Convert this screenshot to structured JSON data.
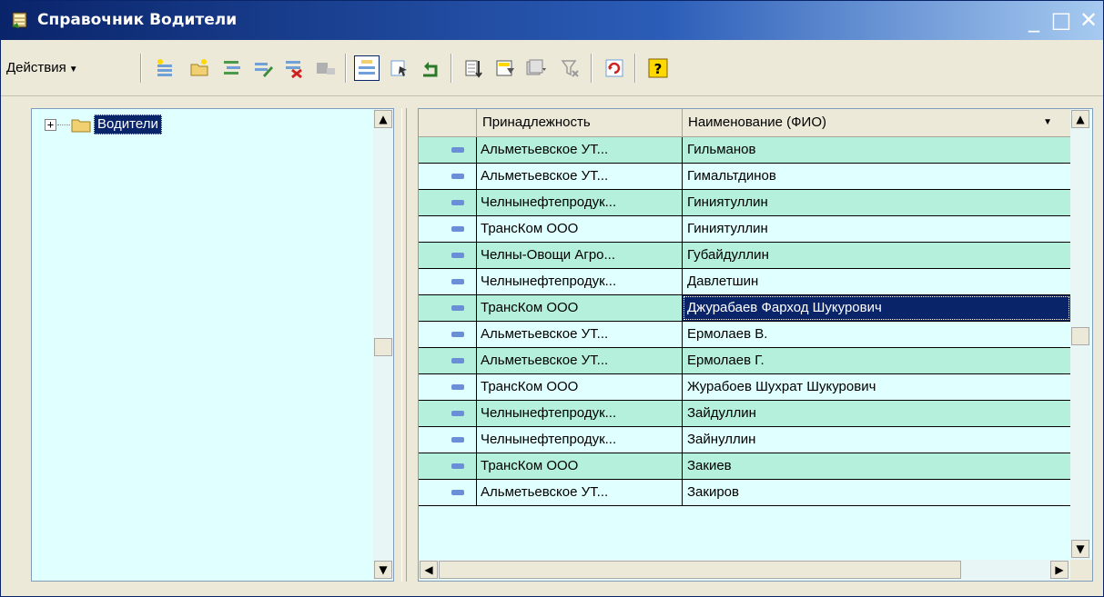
{
  "window": {
    "title": "Справочник Водители",
    "controls": {
      "minimize": "_",
      "maximize": "□",
      "close": "✕"
    }
  },
  "toolbar": {
    "actions_label": "Действия",
    "buttons": [
      "add-item-icon",
      "add-group-icon",
      "copy-item-icon",
      "edit-item-icon",
      "mark-delete-icon",
      "select-ok-icon",
      "hierarchy-view-icon",
      "list-view-icon",
      "go-up-icon",
      "filter-icon",
      "filter-value-icon",
      "filter-history-icon",
      "filter-clear-icon",
      "refresh-icon",
      "help-icon"
    ]
  },
  "tree": {
    "expander": "+",
    "root_label": "Водители"
  },
  "grid": {
    "columns": {
      "icon": "",
      "org": "Принадлежность",
      "name": "Наименование (ФИО)"
    },
    "rows": [
      {
        "org": "Альметьевское УТ...",
        "name": "Гильманов"
      },
      {
        "org": "Альметьевское УТ...",
        "name": "Гимальтдинов"
      },
      {
        "org": "Челнынефтепродук...",
        "name": "Гиниятуллин"
      },
      {
        "org": "ТрансКом ООО",
        "name": "Гиниятуллин"
      },
      {
        "org": "Челны-Овощи Агро...",
        "name": "Губайдуллин"
      },
      {
        "org": "Челнынефтепродук...",
        "name": "Давлетшин"
      },
      {
        "org": "ТрансКом ООО",
        "name": "Джурабаев Фарход Шукурович",
        "selected": true
      },
      {
        "org": "Альметьевское УТ...",
        "name": "Ермолаев В."
      },
      {
        "org": "Альметьевское УТ...",
        "name": "Ермолаев Г."
      },
      {
        "org": "ТрансКом ООО",
        "name": "Журабоев Шухрат Шукурович"
      },
      {
        "org": "Челнынефтепродук...",
        "name": "Зайдуллин"
      },
      {
        "org": "Челнынефтепродук...",
        "name": "Зайнуллин"
      },
      {
        "org": "ТрансКом ООО",
        "name": "Закиев"
      },
      {
        "org": "Альметьевское УТ...",
        "name": "Закиров"
      }
    ]
  },
  "colors": {
    "title_bar_start": "#0a246a",
    "selection": "#0a246a",
    "row_odd": "#b4f0dc",
    "row_even": "#e0ffff",
    "panel_bg": "#e0ffff"
  }
}
